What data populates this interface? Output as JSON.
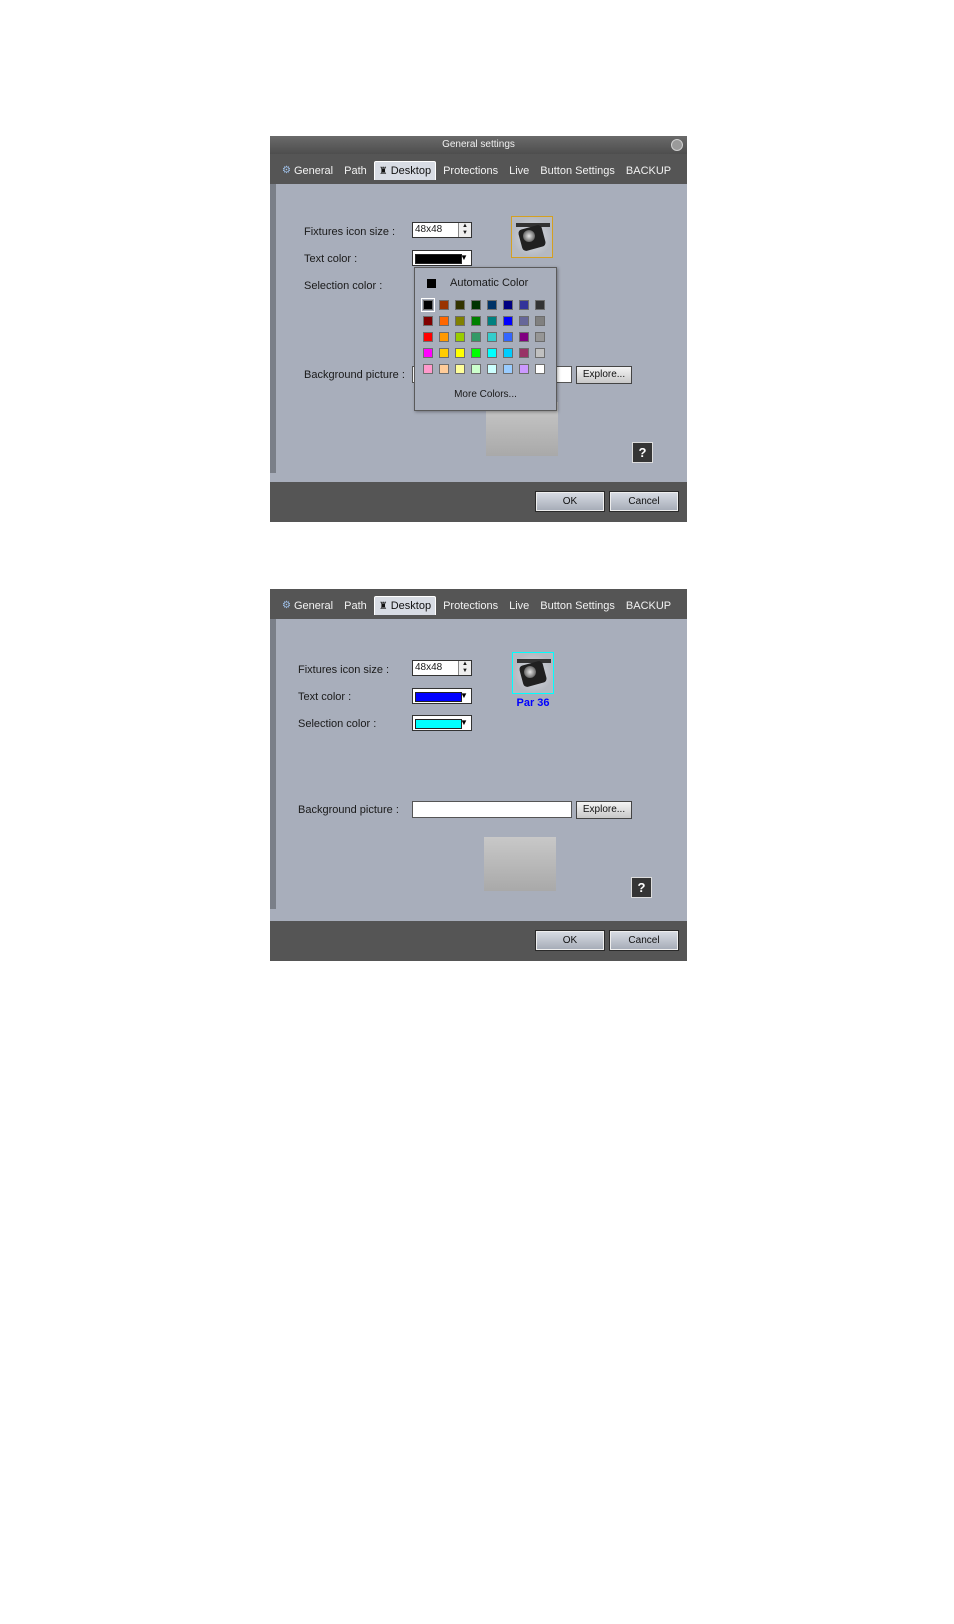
{
  "shot1": {
    "title": "General settings",
    "tabs": [
      "General",
      "Path",
      "Desktop",
      "Protections",
      "Live",
      "Button Settings",
      "BACKUP"
    ],
    "active_tab": "Desktop",
    "fixtures_icon_size_label": "Fixtures icon size :",
    "fixtures_icon_size_value": "48x48",
    "text_color_label": "Text color :",
    "text_color_value": "#000000",
    "selection_color_label": "Selection color :",
    "background_picture_label": "Background picture :",
    "explore_label": "Explore...",
    "help_label": "?",
    "ok_label": "OK",
    "cancel_label": "Cancel",
    "color_popup": {
      "automatic_label": "Automatic Color",
      "more_colors_label": "More Colors...",
      "selected_index": 0,
      "colors": [
        "#000000",
        "#993300",
        "#333300",
        "#003300",
        "#003366",
        "#000080",
        "#333399",
        "#333333",
        "#800000",
        "#ff6600",
        "#808000",
        "#008000",
        "#008080",
        "#0000ff",
        "#666699",
        "#808080",
        "#ff0000",
        "#ff9900",
        "#99cc00",
        "#339966",
        "#33cccc",
        "#3366ff",
        "#800080",
        "#969696",
        "#ff00ff",
        "#ffcc00",
        "#ffff00",
        "#00ff00",
        "#00ffff",
        "#00ccff",
        "#993366",
        "#c0c0c0",
        "#ff99cc",
        "#ffcc99",
        "#ffff99",
        "#ccffcc",
        "#ccffff",
        "#99ccff",
        "#cc99ff",
        "#ffffff"
      ]
    }
  },
  "shot2": {
    "tabs": [
      "General",
      "Path",
      "Desktop",
      "Protections",
      "Live",
      "Button Settings",
      "BACKUP"
    ],
    "active_tab": "Desktop",
    "fixtures_icon_size_label": "Fixtures icon size :",
    "fixtures_icon_size_value": "48x48",
    "text_color_label": "Text color :",
    "text_color_value": "#0000ff",
    "selection_color_label": "Selection color :",
    "selection_color_value": "#00ffff",
    "fixture_label": "Par 36",
    "background_picture_label": "Background picture :",
    "explore_label": "Explore...",
    "help_label": "?",
    "ok_label": "OK",
    "cancel_label": "Cancel"
  }
}
